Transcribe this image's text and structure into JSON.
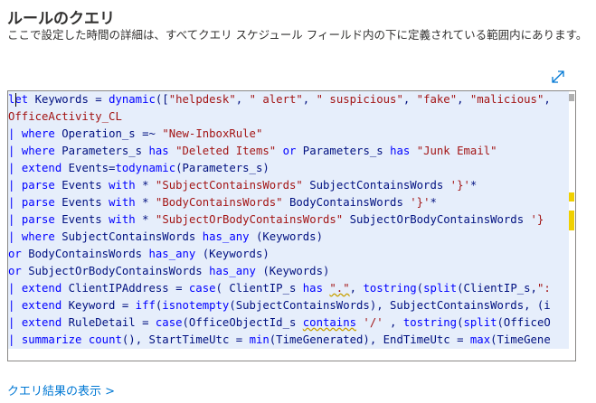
{
  "header": {
    "title": "ルールのクエリ",
    "description": "ここで設定した時間の詳細は、すべてクエリ スケジュール フィールド内の下に定義されている範囲内にあります。"
  },
  "icons": {
    "expand": "expand-diagonal-icon"
  },
  "colors": {
    "accent": "#0078d4",
    "keyword": "#0000ff",
    "string": "#a31515",
    "identifier": "#001080"
  },
  "code_lines": [
    [
      {
        "t": "kw",
        "v": "let"
      },
      {
        "t": "plain",
        "v": " Keywords = "
      },
      {
        "t": "fn",
        "v": "dynamic"
      },
      {
        "t": "plain",
        "v": "(["
      },
      {
        "t": "str",
        "v": "\"helpdesk\""
      },
      {
        "t": "plain",
        "v": ", "
      },
      {
        "t": "str",
        "v": "\" alert\""
      },
      {
        "t": "plain",
        "v": ", "
      },
      {
        "t": "str",
        "v": "\" suspicious\""
      },
      {
        "t": "plain",
        "v": ", "
      },
      {
        "t": "str",
        "v": "\"fake\""
      },
      {
        "t": "plain",
        "v": ", "
      },
      {
        "t": "str",
        "v": "\"malicious\""
      },
      {
        "t": "plain",
        "v": ", "
      }
    ],
    [
      {
        "t": "tbl",
        "v": "OfficeActivity_CL"
      }
    ],
    [
      {
        "t": "pipe",
        "v": "| "
      },
      {
        "t": "kw",
        "v": "where"
      },
      {
        "t": "plain",
        "v": " Operation_s =~ "
      },
      {
        "t": "str",
        "v": "\"New-InboxRule\""
      }
    ],
    [
      {
        "t": "pipe",
        "v": "| "
      },
      {
        "t": "kw",
        "v": "where"
      },
      {
        "t": "plain",
        "v": " Parameters_s "
      },
      {
        "t": "kw",
        "v": "has"
      },
      {
        "t": "plain",
        "v": " "
      },
      {
        "t": "str",
        "v": "\"Deleted Items\""
      },
      {
        "t": "plain",
        "v": " "
      },
      {
        "t": "kw",
        "v": "or"
      },
      {
        "t": "plain",
        "v": " Parameters_s "
      },
      {
        "t": "kw",
        "v": "has"
      },
      {
        "t": "plain",
        "v": " "
      },
      {
        "t": "str",
        "v": "\"Junk Email\""
      }
    ],
    [
      {
        "t": "pipe",
        "v": "| "
      },
      {
        "t": "kw",
        "v": "extend"
      },
      {
        "t": "plain",
        "v": " Events="
      },
      {
        "t": "fn",
        "v": "todynamic"
      },
      {
        "t": "plain",
        "v": "(Parameters_s)"
      }
    ],
    [
      {
        "t": "pipe",
        "v": "| "
      },
      {
        "t": "kw",
        "v": "parse"
      },
      {
        "t": "plain",
        "v": " Events "
      },
      {
        "t": "kw",
        "v": "with"
      },
      {
        "t": "plain",
        "v": " * "
      },
      {
        "t": "str",
        "v": "\"SubjectContainsWords\""
      },
      {
        "t": "plain",
        "v": " SubjectContainsWords "
      },
      {
        "t": "str",
        "v": "'}'"
      },
      {
        "t": "plain",
        "v": "*"
      }
    ],
    [
      {
        "t": "pipe",
        "v": "| "
      },
      {
        "t": "kw",
        "v": "parse"
      },
      {
        "t": "plain",
        "v": " Events "
      },
      {
        "t": "kw",
        "v": "with"
      },
      {
        "t": "plain",
        "v": " * "
      },
      {
        "t": "str",
        "v": "\"BodyContainsWords\""
      },
      {
        "t": "plain",
        "v": " BodyContainsWords "
      },
      {
        "t": "str",
        "v": "'}'"
      },
      {
        "t": "plain",
        "v": "*"
      }
    ],
    [
      {
        "t": "pipe",
        "v": "| "
      },
      {
        "t": "kw",
        "v": "parse"
      },
      {
        "t": "plain",
        "v": " Events "
      },
      {
        "t": "kw",
        "v": "with"
      },
      {
        "t": "plain",
        "v": " * "
      },
      {
        "t": "str",
        "v": "\"SubjectOrBodyContainsWords\""
      },
      {
        "t": "plain",
        "v": " SubjectOrBodyContainsWords "
      },
      {
        "t": "str",
        "v": "'}"
      }
    ],
    [
      {
        "t": "pipe",
        "v": "| "
      },
      {
        "t": "kw",
        "v": "where"
      },
      {
        "t": "plain",
        "v": " SubjectContainsWords "
      },
      {
        "t": "kw",
        "v": "has_any"
      },
      {
        "t": "plain",
        "v": " (Keywords)"
      }
    ],
    [
      {
        "t": "kw",
        "v": "or"
      },
      {
        "t": "plain",
        "v": " BodyContainsWords "
      },
      {
        "t": "kw",
        "v": "has_any"
      },
      {
        "t": "plain",
        "v": " (Keywords)"
      }
    ],
    [
      {
        "t": "kw",
        "v": "or"
      },
      {
        "t": "plain",
        "v": " SubjectOrBodyContainsWords "
      },
      {
        "t": "kw",
        "v": "has_any"
      },
      {
        "t": "plain",
        "v": " (Keywords)"
      }
    ],
    [
      {
        "t": "pipe",
        "v": "| "
      },
      {
        "t": "kw",
        "v": "extend"
      },
      {
        "t": "plain",
        "v": " ClientIPAddress = "
      },
      {
        "t": "kw",
        "v": "case"
      },
      {
        "t": "plain",
        "v": "( ClientIP_s "
      },
      {
        "t": "kw",
        "v": "has"
      },
      {
        "t": "plain",
        "v": " "
      },
      {
        "t": "sq",
        "v": "\".\""
      },
      {
        "t": "plain",
        "v": ", "
      },
      {
        "t": "fn",
        "v": "tostring"
      },
      {
        "t": "plain",
        "v": "("
      },
      {
        "t": "fn",
        "v": "split"
      },
      {
        "t": "plain",
        "v": "(ClientIP_s,"
      },
      {
        "t": "str",
        "v": "\":"
      }
    ],
    [
      {
        "t": "pipe",
        "v": "| "
      },
      {
        "t": "kw",
        "v": "extend"
      },
      {
        "t": "plain",
        "v": " Keyword = "
      },
      {
        "t": "fn",
        "v": "iff"
      },
      {
        "t": "plain",
        "v": "("
      },
      {
        "t": "fn",
        "v": "isnotempty"
      },
      {
        "t": "plain",
        "v": "(SubjectContainsWords), SubjectContainsWords, (i"
      }
    ],
    [
      {
        "t": "pipe",
        "v": "| "
      },
      {
        "t": "kw",
        "v": "extend"
      },
      {
        "t": "plain",
        "v": " RuleDetail = "
      },
      {
        "t": "kw",
        "v": "case"
      },
      {
        "t": "plain",
        "v": "(OfficeObjectId_s "
      },
      {
        "t": "sqkw",
        "v": "contains"
      },
      {
        "t": "plain",
        "v": " "
      },
      {
        "t": "str",
        "v": "'/'"
      },
      {
        "t": "plain",
        "v": " , "
      },
      {
        "t": "fn",
        "v": "tostring"
      },
      {
        "t": "plain",
        "v": "("
      },
      {
        "t": "fn",
        "v": "split"
      },
      {
        "t": "plain",
        "v": "(OfficeO"
      }
    ],
    [
      {
        "t": "pipe",
        "v": "| "
      },
      {
        "t": "kw",
        "v": "summarize"
      },
      {
        "t": "plain",
        "v": " "
      },
      {
        "t": "fn",
        "v": "count"
      },
      {
        "t": "plain",
        "v": "(), StartTimeUtc = "
      },
      {
        "t": "fn",
        "v": "min"
      },
      {
        "t": "plain",
        "v": "(TimeGenerated), EndTimeUtc = "
      },
      {
        "t": "fn",
        "v": "max"
      },
      {
        "t": "plain",
        "v": "(TimeGene"
      }
    ]
  ],
  "footer": {
    "link_label": "クエリ結果の表示 >"
  }
}
